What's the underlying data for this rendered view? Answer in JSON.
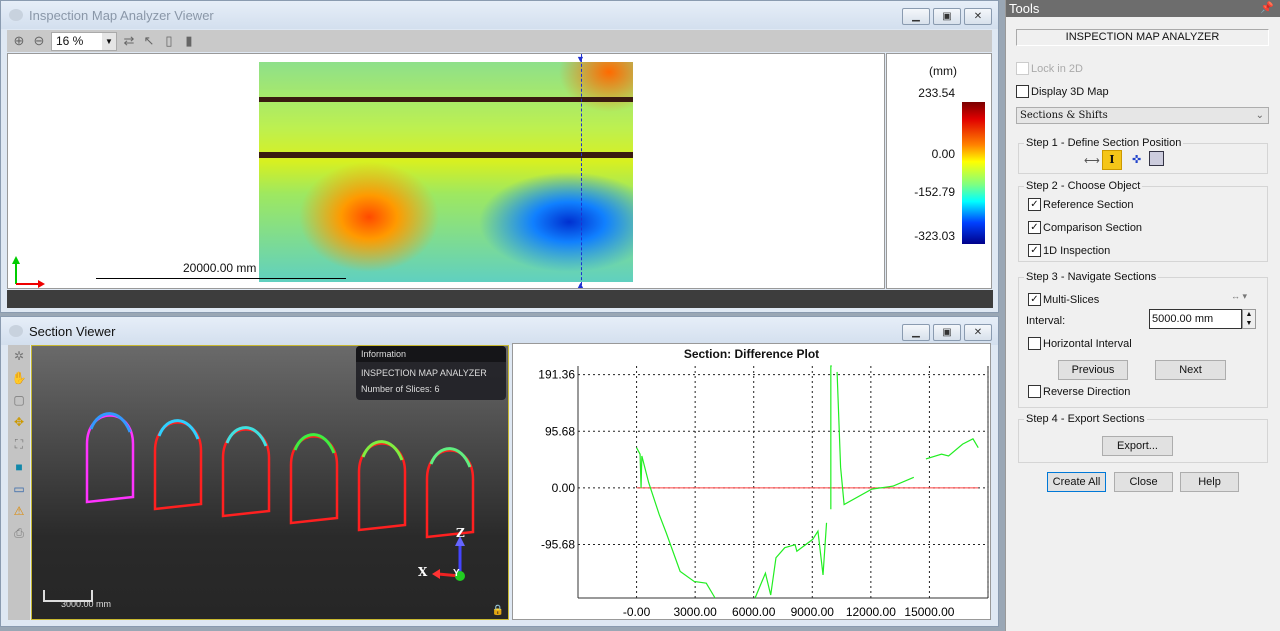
{
  "map_viewer": {
    "title": "Inspection Map Analyzer Viewer",
    "zoom": "16 %",
    "scale_label": "20000.00 mm",
    "legend": {
      "unit": "(mm)",
      "labels": [
        "233.54",
        "0.00",
        "-152.79",
        "-323.03"
      ]
    }
  },
  "section_viewer": {
    "title": "Section Viewer",
    "info": {
      "header": "Information",
      "line1": "INSPECTION MAP ANALYZER",
      "line2": "Number of Slices: 6"
    },
    "scale_label": "3000.00 mm",
    "axes": {
      "x": "X",
      "y": "Y",
      "z": "Z"
    },
    "slice_count": 6
  },
  "chart_data": {
    "type": "line",
    "title": "Section: Difference Plot",
    "x_ticks": [
      "-0.00",
      "3000.00",
      "6000.00",
      "9000.00",
      "12000.00",
      "15000.00"
    ],
    "y_ticks": [
      "191.36",
      "95.68",
      "0.00",
      "-95.68"
    ],
    "xlim": [
      -3000,
      18000
    ],
    "ylim": [
      -186,
      206
    ],
    "grid": true,
    "reference": {
      "color": "#ff4040",
      "points": [
        [
          0,
          0
        ],
        [
          17500,
          0
        ]
      ]
    },
    "series": [
      {
        "color": "#22ee22",
        "segments": [
          [
            [
              0,
              68
            ],
            [
              180,
              57
            ],
            [
              230,
              0
            ],
            [
              270,
              54
            ],
            [
              620,
              9
            ],
            [
              1160,
              -45
            ],
            [
              1520,
              -76
            ],
            [
              2230,
              -141
            ],
            [
              2950,
              -158
            ],
            [
              3570,
              -161
            ],
            [
              4020,
              -186
            ]
          ],
          [
            [
              6070,
              -186
            ],
            [
              6600,
              -144
            ],
            [
              6870,
              -181
            ],
            [
              7140,
              -118
            ],
            [
              7590,
              -101
            ],
            [
              8120,
              -96
            ],
            [
              8210,
              -107
            ],
            [
              9020,
              -87
            ],
            [
              9290,
              -73
            ],
            [
              9550,
              -147
            ],
            [
              9730,
              -59
            ]
          ],
          [
            [
              9950,
              -36
            ],
            [
              9950,
              206
            ],
            [
              10000,
              206
            ]
          ],
          [
            [
              10270,
              196
            ],
            [
              10450,
              35
            ],
            [
              10630,
              -28
            ],
            [
              12050,
              -2
            ],
            [
              13130,
              3
            ],
            [
              14200,
              18
            ]
          ],
          [
            [
              14820,
              49
            ],
            [
              15620,
              57
            ],
            [
              15980,
              54
            ],
            [
              16700,
              74
            ],
            [
              17230,
              83
            ],
            [
              17500,
              68
            ]
          ]
        ]
      }
    ]
  },
  "tools": {
    "title": "Tools",
    "header": "INSPECTION MAP ANALYZER",
    "lock2d": "Lock in 2D",
    "display3d": "Display 3D Map",
    "mode": "Sections & Shifts",
    "step1": "Step 1 - Define Section Position",
    "step2": "Step 2 - Choose Object",
    "reference": "Reference Section",
    "comparison": "Comparison Section",
    "inspection1d": "1D Inspection",
    "step3": "Step 3 - Navigate Sections",
    "multi": "Multi-Slices",
    "interval_label": "Interval:",
    "interval": "5000.00 mm",
    "horizontal": "Horizontal Interval",
    "previous": "Previous",
    "next": "Next",
    "reverse": "Reverse Direction",
    "step4": "Step 4 - Export Sections",
    "export": "Export...",
    "create_all": "Create All",
    "close": "Close",
    "help": "Help"
  }
}
